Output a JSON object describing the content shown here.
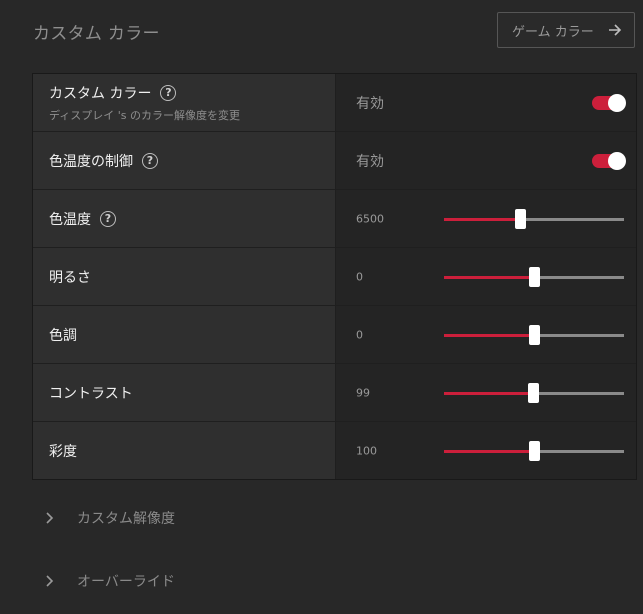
{
  "page": {
    "title": "カスタム カラー"
  },
  "header": {
    "game_color_label": "ゲーム カラー"
  },
  "rows": [
    {
      "label": "カスタム カラー",
      "sublabel": "ディスプレイ 's のカラー解像度を変更",
      "help": "?",
      "value": "有効",
      "toggle_on": true
    },
    {
      "label": "色温度の制御",
      "help": "?",
      "value": "有効",
      "toggle_on": true
    },
    {
      "label": "色温度",
      "help": "?",
      "value": "6500",
      "slider_fraction": 0.42
    },
    {
      "label": "明るさ",
      "value": "0",
      "slider_fraction": 0.5
    },
    {
      "label": "色調",
      "value": "0",
      "slider_fraction": 0.5
    },
    {
      "label": "コントラスト",
      "value": "99",
      "slider_fraction": 0.495
    },
    {
      "label": "彩度",
      "value": "100",
      "slider_fraction": 0.5
    }
  ],
  "sections": [
    {
      "label": "カスタム解像度"
    },
    {
      "label": "オーバーライド"
    }
  ],
  "colors": {
    "accent": "#cc1f3b",
    "background": "#282828"
  },
  "icons": {
    "header_button": "arrow-right-icon",
    "help": "question-circle-icon",
    "section": "chevron-right-icon"
  }
}
